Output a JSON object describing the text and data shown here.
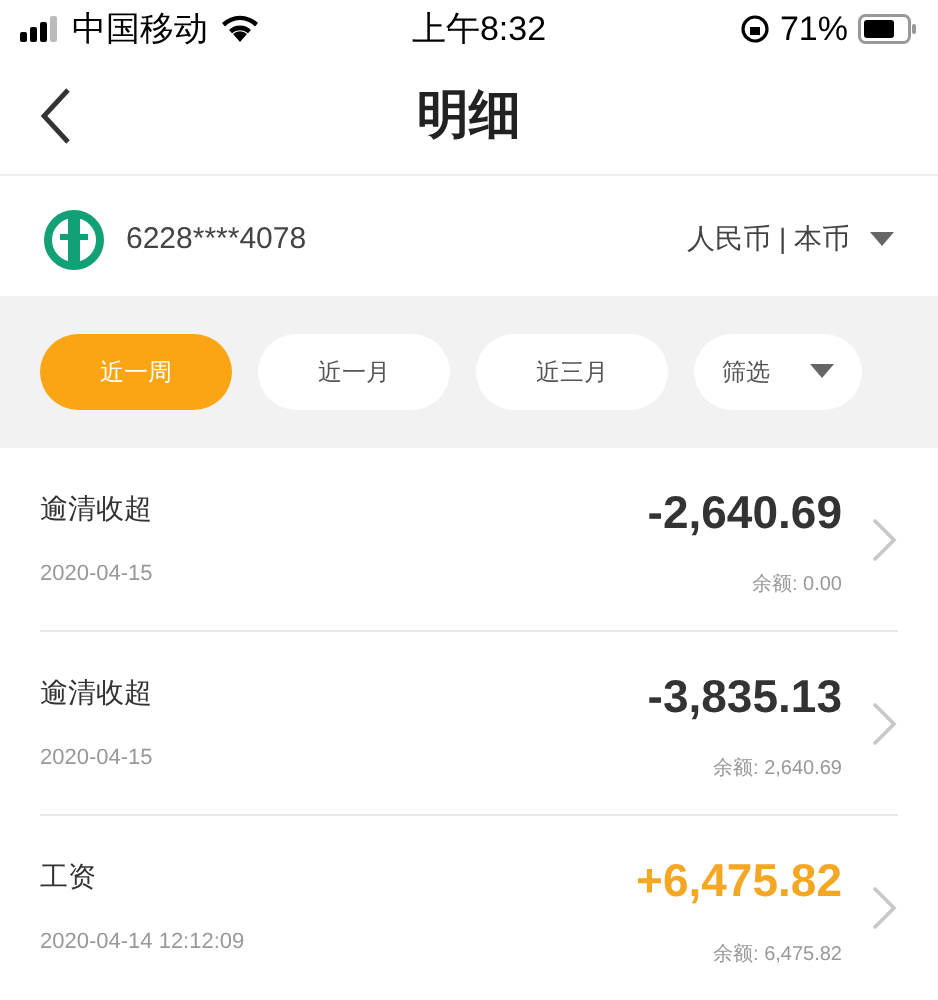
{
  "status_bar": {
    "carrier": "中国移动",
    "time": "上午8:32",
    "battery": "71%"
  },
  "nav": {
    "title": "明细"
  },
  "account": {
    "number": "6228****4078",
    "currency": "人民币 | 本币"
  },
  "filters": [
    {
      "label": "近一周",
      "selected": true,
      "kind": "tab"
    },
    {
      "label": "近一月",
      "selected": false,
      "kind": "tab"
    },
    {
      "label": "近三月",
      "selected": false,
      "kind": "tab"
    },
    {
      "label": "筛选",
      "selected": false,
      "kind": "dropdown"
    }
  ],
  "transactions": [
    {
      "title": "逾清收超",
      "date": "2020-04-15",
      "amount": "-2,640.69",
      "balance": "余额: 0.00",
      "kind": "debit"
    },
    {
      "title": "逾清收超",
      "date": "2020-04-15",
      "amount": "-3,835.13",
      "balance": "余额: 2,640.69",
      "kind": "debit"
    },
    {
      "title": "工资",
      "date": "2020-04-14 12:12:09",
      "amount": "+6,475.82",
      "balance": "余额: 6,475.82",
      "kind": "credit"
    }
  ]
}
